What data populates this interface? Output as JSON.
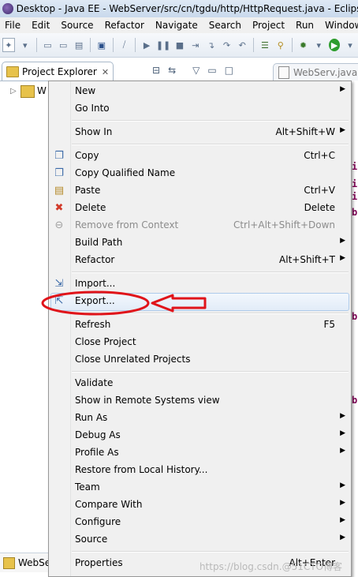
{
  "window": {
    "title": "Desktop - Java EE - WebServer/src/cn/tgdu/http/HttpRequest.java - Eclipse"
  },
  "menubar": [
    "File",
    "Edit",
    "Source",
    "Refactor",
    "Navigate",
    "Search",
    "Project",
    "Run",
    "Window"
  ],
  "view": {
    "title": "Project Explorer",
    "close_glyph": "✕",
    "tree_item": "W"
  },
  "editor": {
    "tab": "WebServ.java",
    "code_fragments": [
      "i",
      "i",
      "i",
      "b",
      "b",
      "b"
    ]
  },
  "bottom_tab": {
    "label": "WebSe"
  },
  "context_menu": {
    "groups": [
      [
        {
          "label": "New",
          "submenu": true
        },
        {
          "label": "Go Into"
        }
      ],
      [
        {
          "label": "Show In",
          "shortcut": "Alt+Shift+W",
          "submenu": true
        }
      ],
      [
        {
          "label": "Copy",
          "shortcut": "Ctrl+C",
          "icon": "copy-icon"
        },
        {
          "label": "Copy Qualified Name",
          "icon": "copy-qualified-icon"
        },
        {
          "label": "Paste",
          "shortcut": "Ctrl+V",
          "icon": "paste-icon"
        },
        {
          "label": "Delete",
          "shortcut": "Delete",
          "icon": "delete-icon"
        },
        {
          "label": "Remove from Context",
          "shortcut": "Ctrl+Alt+Shift+Down",
          "icon": "remove-context-icon",
          "disabled": true
        },
        {
          "label": "Build Path",
          "submenu": true
        },
        {
          "label": "Refactor",
          "shortcut": "Alt+Shift+T",
          "submenu": true
        }
      ],
      [
        {
          "label": "Import...",
          "icon": "import-icon"
        },
        {
          "label": "Export...",
          "icon": "export-icon",
          "highlighted": true
        }
      ],
      [
        {
          "label": "Refresh",
          "shortcut": "F5"
        },
        {
          "label": "Close Project"
        },
        {
          "label": "Close Unrelated Projects"
        }
      ],
      [
        {
          "label": "Validate"
        },
        {
          "label": "Show in Remote Systems view"
        },
        {
          "label": "Run As",
          "submenu": true
        },
        {
          "label": "Debug As",
          "submenu": true
        },
        {
          "label": "Profile As",
          "submenu": true
        },
        {
          "label": "Restore from Local History..."
        },
        {
          "label": "Team",
          "submenu": true
        },
        {
          "label": "Compare With",
          "submenu": true
        },
        {
          "label": "Configure",
          "submenu": true
        },
        {
          "label": "Source",
          "submenu": true
        }
      ],
      [
        {
          "label": "Properties",
          "shortcut": "Alt+Enter"
        }
      ]
    ]
  },
  "annotation": {
    "color": "#e0141a"
  },
  "watermark": "https://blog.csdn.@51CTO博客"
}
